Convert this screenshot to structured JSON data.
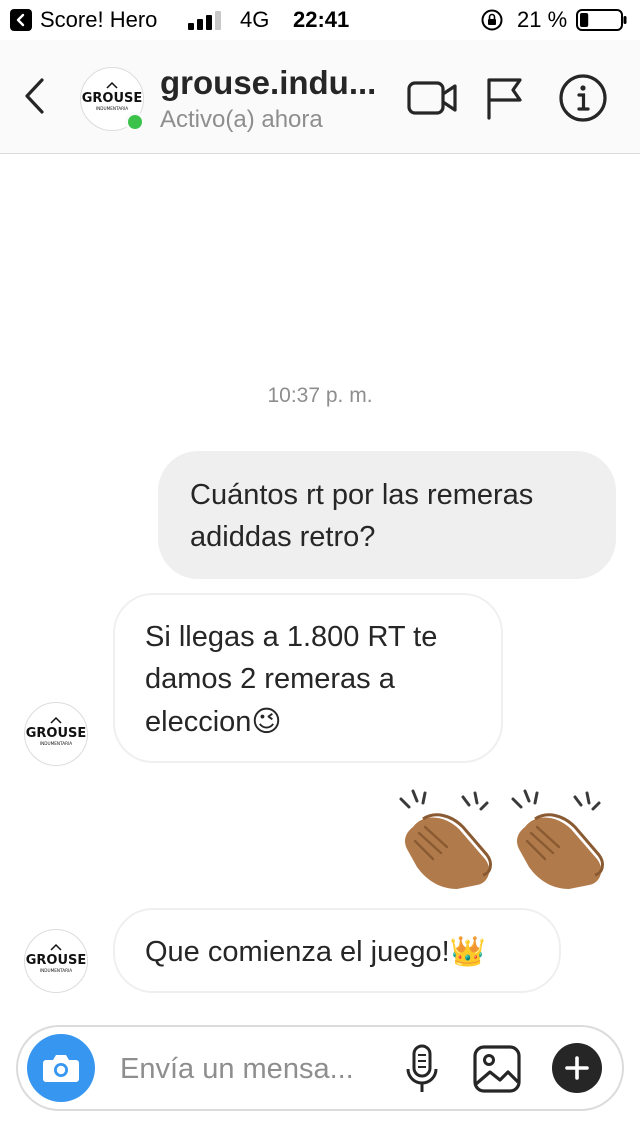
{
  "status_bar": {
    "back_app": "Score! Hero",
    "network": "4G",
    "time": "22:41",
    "battery_percent": "21 %",
    "battery_level": 0.21,
    "signal_bars": 3
  },
  "header": {
    "username": "grouse.indu...",
    "activity": "Activo(a) ahora",
    "avatar_logo_text": "GROUSE",
    "avatar_logo_subtext": "INDUMENTARIA",
    "active_color": "#3bc24b"
  },
  "chat": {
    "timestamp": "10:37 p. m.",
    "messages": [
      {
        "from": "me",
        "text": "Cuántos rt por las remeras adiddas retro?"
      },
      {
        "from": "them",
        "text": "Si llegas a 1.800 RT te damos 2 remeras a eleccion",
        "emoji": "😉"
      },
      {
        "from": "me",
        "emoji_only": "👏🏽👏🏽"
      },
      {
        "from": "them",
        "text": "Que comienza el juego!",
        "emoji": "👑"
      }
    ]
  },
  "composer": {
    "placeholder": "Envía un mensa...",
    "camera_color": "#3797f0"
  },
  "icons": {
    "back": "chevron-left-icon",
    "video": "video-camera-icon",
    "flag": "flag-icon",
    "info": "info-icon",
    "camera": "camera-icon",
    "mic": "microphone-icon",
    "gallery": "image-icon",
    "plus": "plus-icon"
  }
}
